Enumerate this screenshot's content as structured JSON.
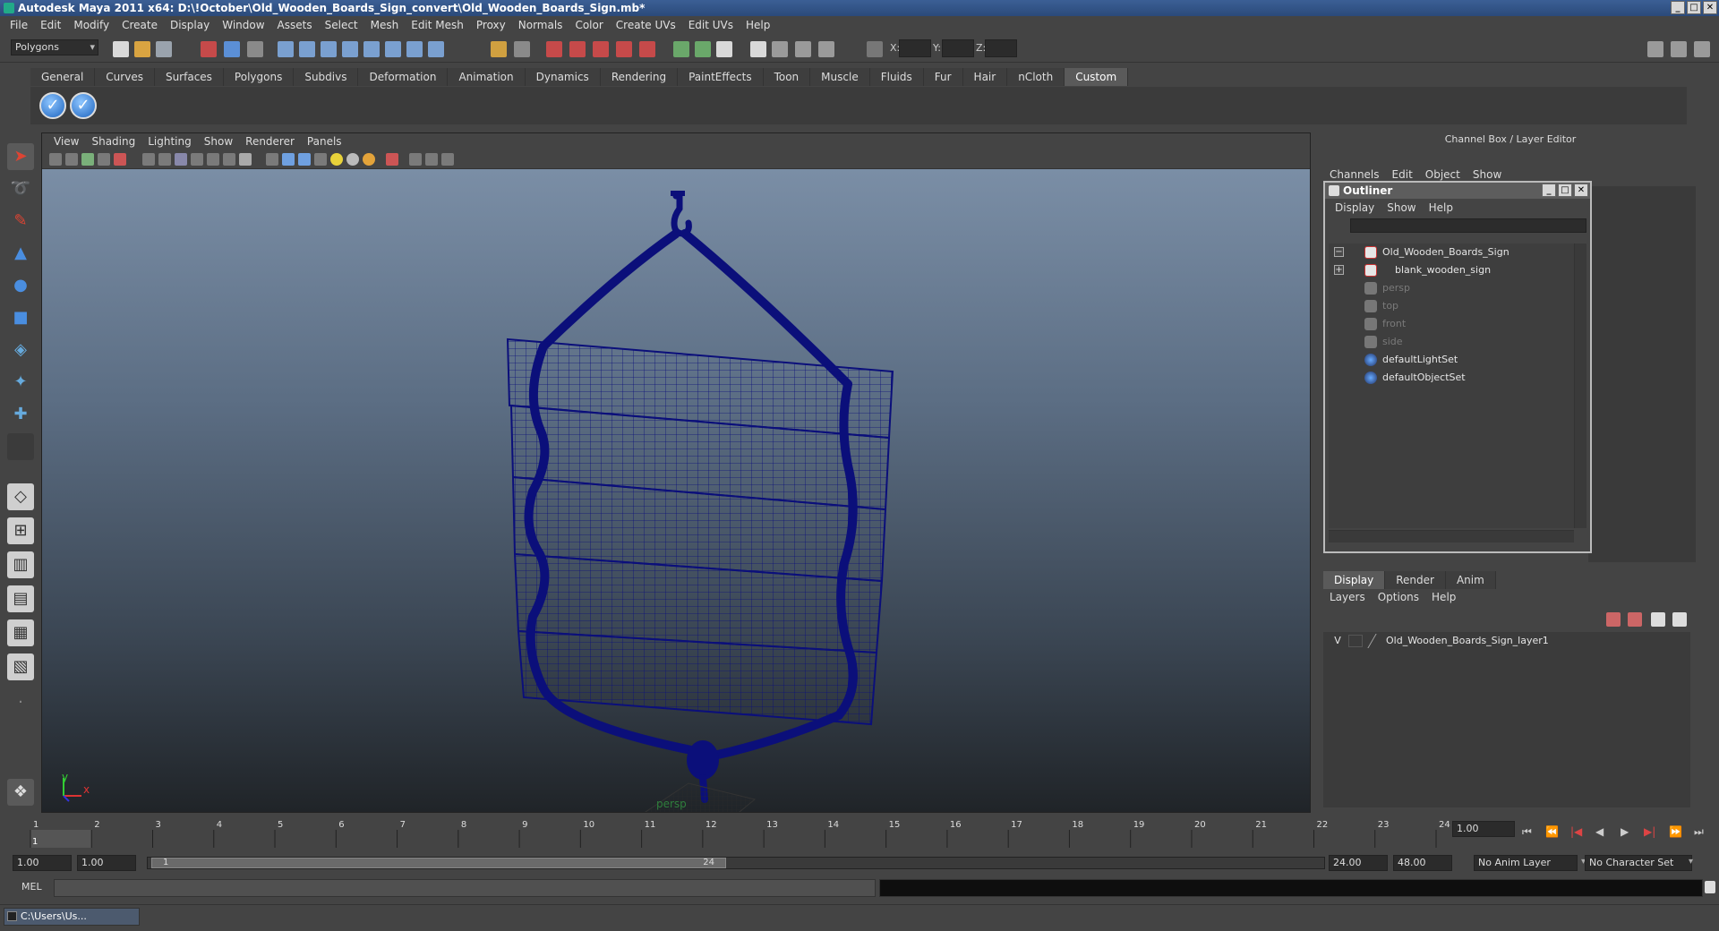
{
  "window": {
    "title": "Autodesk Maya 2011 x64: D:\\!October\\Old_Wooden_Boards_Sign_convert\\Old_Wooden_Boards_Sign.mb*"
  },
  "menubar": {
    "items": [
      "File",
      "Edit",
      "Modify",
      "Create",
      "Display",
      "Window",
      "Assets",
      "Select",
      "Mesh",
      "Edit Mesh",
      "Proxy",
      "Normals",
      "Color",
      "Create UVs",
      "Edit UVs",
      "Help"
    ]
  },
  "statusline": {
    "mode": "Polygons",
    "x_label": "X:",
    "y_label": "Y:",
    "z_label": "Z:"
  },
  "shelf": {
    "tabs": [
      "General",
      "Curves",
      "Surfaces",
      "Polygons",
      "Subdivs",
      "Deformation",
      "Animation",
      "Dynamics",
      "Rendering",
      "PaintEffects",
      "Toon",
      "Muscle",
      "Fluids",
      "Fur",
      "Hair",
      "nCloth",
      "Custom"
    ],
    "active_tab": "Custom"
  },
  "viewport": {
    "menu": [
      "View",
      "Shading",
      "Lighting",
      "Show",
      "Renderer",
      "Panels"
    ],
    "camera_label": "persp",
    "axis_x": "x",
    "axis_y": "y",
    "wire_color": "#0b0f7a"
  },
  "channelbox": {
    "header": "Channel Box / Layer Editor",
    "menu": [
      "Channels",
      "Edit",
      "Object",
      "Show"
    ]
  },
  "outliner": {
    "title": "Outliner",
    "menu": [
      "Display",
      "Show",
      "Help"
    ],
    "items": [
      {
        "label": "Old_Wooden_Boards_Sign",
        "dim": false
      },
      {
        "label": "blank_wooden_sign",
        "dim": false
      },
      {
        "label": "persp",
        "dim": true
      },
      {
        "label": "top",
        "dim": true
      },
      {
        "label": "front",
        "dim": true
      },
      {
        "label": "side",
        "dim": true
      },
      {
        "label": "defaultLightSet",
        "dim": false
      },
      {
        "label": "defaultObjectSet",
        "dim": false
      }
    ]
  },
  "layereditor": {
    "tabs": [
      "Display",
      "Render",
      "Anim"
    ],
    "active_tab": "Display",
    "menu": [
      "Layers",
      "Options",
      "Help"
    ],
    "layer": {
      "visible": "V",
      "name": "Old_Wooden_Boards_Sign_layer1"
    }
  },
  "timeslider": {
    "ticks": [
      "1",
      "2",
      "3",
      "4",
      "5",
      "6",
      "7",
      "8",
      "9",
      "10",
      "11",
      "12",
      "13",
      "14",
      "15",
      "16",
      "17",
      "18",
      "19",
      "20",
      "21",
      "22",
      "23",
      "24"
    ],
    "current_marker": "1",
    "current_frame": "1.00"
  },
  "rangeslider": {
    "start_time": "1.00",
    "playback_start": "1.00",
    "range_start_label": "1",
    "range_end_label": "24",
    "playback_end": "24.00",
    "end_time": "48.00",
    "anim_layer": "No Anim Layer",
    "character_set": "No Character Set"
  },
  "commandline": {
    "label": "MEL"
  },
  "taskbar": {
    "item": "C:\\Users\\Us..."
  }
}
